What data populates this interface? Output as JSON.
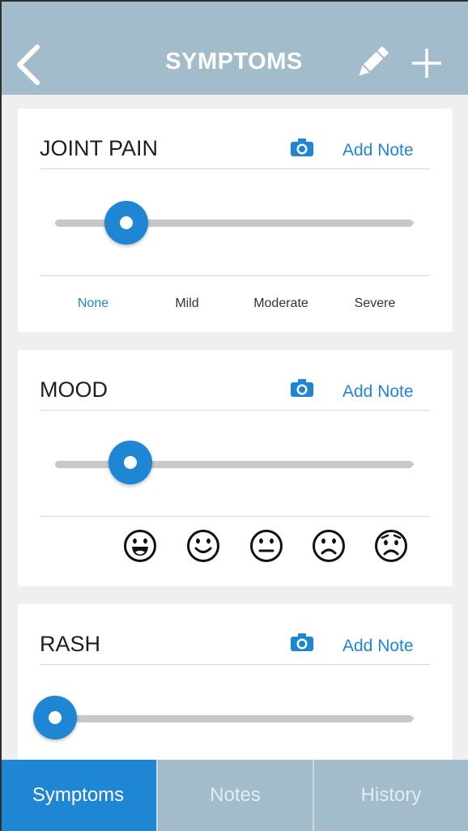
{
  "header": {
    "title": "SYMPTOMS",
    "back_icon": "chevron-left-icon",
    "edit_icon": "pencil-icon",
    "add_icon": "plus-icon"
  },
  "cards": [
    {
      "title": "JOINT PAIN",
      "camera_icon": "camera-icon",
      "note_label": "Add Note",
      "slider_value_fraction": 0.2,
      "scale_labels": [
        "None",
        "Mild",
        "Moderate",
        "Severe"
      ],
      "selected_label": "None"
    },
    {
      "title": "MOOD",
      "camera_icon": "camera-icon",
      "note_label": "Add Note",
      "slider_value_fraction": 0.21,
      "faces": [
        "grinning-face-icon",
        "smiling-face-icon",
        "neutral-face-icon",
        "frowning-face-icon",
        "worried-face-icon"
      ]
    },
    {
      "title": "RASH",
      "camera_icon": "camera-icon",
      "note_label": "Add Note",
      "slider_value_fraction": 0.0
    }
  ],
  "tabs": [
    {
      "label": "Symptoms",
      "active": true
    },
    {
      "label": "Notes",
      "active": false
    },
    {
      "label": "History",
      "active": false
    }
  ],
  "colors": {
    "header_bg": "#a2bccb",
    "accent": "#1f86d3",
    "page_bg": "#efefef",
    "track": "#c8c8c8"
  }
}
